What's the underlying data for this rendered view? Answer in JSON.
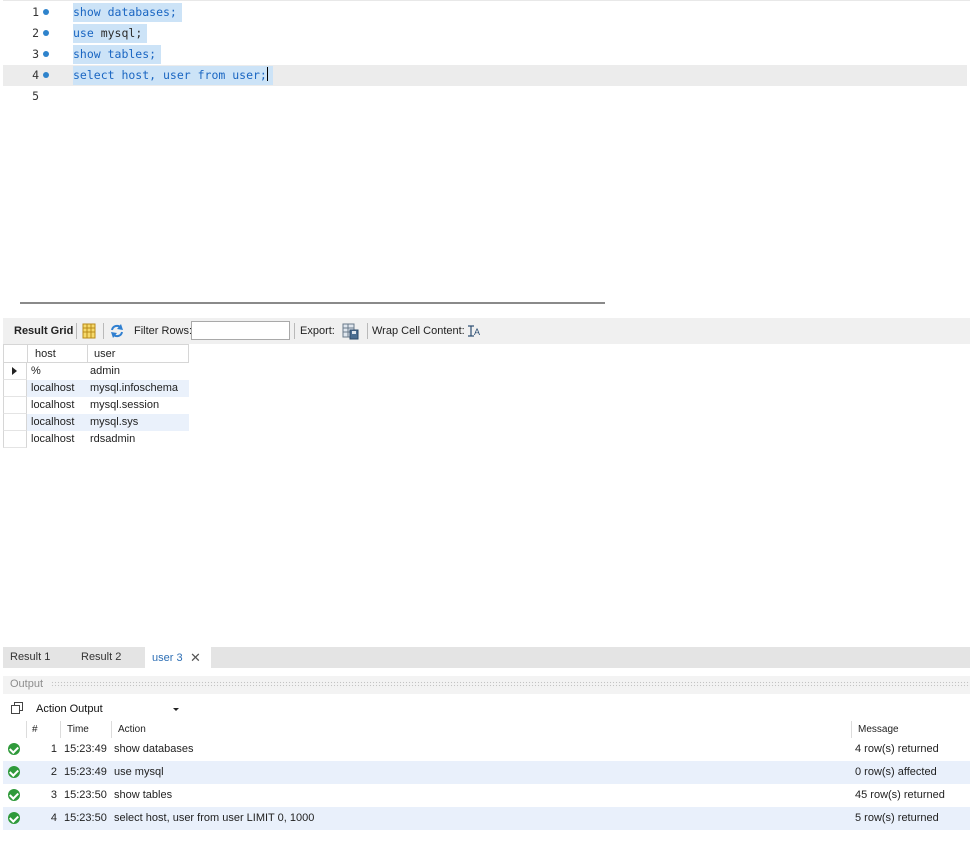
{
  "editor": {
    "lines": [
      {
        "number": "1",
        "tokens": [
          {
            "text": "show databases;",
            "type": "kw"
          }
        ]
      },
      {
        "number": "2",
        "tokens": [
          {
            "text": "use ",
            "type": "kw"
          },
          {
            "text": "mysql;",
            "type": "id"
          }
        ]
      },
      {
        "number": "3",
        "tokens": [
          {
            "text": "show tables;",
            "type": "kw"
          }
        ]
      },
      {
        "number": "4",
        "tokens": [
          {
            "text": "select host, user from user;",
            "type": "kw"
          }
        ]
      },
      {
        "number": "5",
        "tokens": []
      }
    ]
  },
  "result_toolbar": {
    "result_grid_label": "Result Grid",
    "filter_rows_label": "Filter Rows:",
    "filter_value": "",
    "export_label": "Export:",
    "wrap_label": "Wrap Cell Content:"
  },
  "grid": {
    "columns": [
      "host",
      "user"
    ],
    "rows": [
      {
        "host": "%",
        "user": "admin"
      },
      {
        "host": "localhost",
        "user": "mysql.infoschema"
      },
      {
        "host": "localhost",
        "user": "mysql.session"
      },
      {
        "host": "localhost",
        "user": "mysql.sys"
      },
      {
        "host": "localhost",
        "user": "rdsadmin"
      }
    ]
  },
  "result_tabs": [
    {
      "label": "Result 1",
      "active": false
    },
    {
      "label": "Result 2",
      "active": false
    },
    {
      "label": "user 3",
      "active": true
    }
  ],
  "output": {
    "title": "Output",
    "mode": "Action Output",
    "columns": [
      "#",
      "Time",
      "Action",
      "Message"
    ],
    "rows": [
      {
        "num": "1",
        "time": "15:23:49",
        "action": "show databases",
        "message": "4 row(s) returned"
      },
      {
        "num": "2",
        "time": "15:23:49",
        "action": "use mysql",
        "message": "0 row(s) affected"
      },
      {
        "num": "3",
        "time": "15:23:50",
        "action": "show tables",
        "message": "45 row(s) returned"
      },
      {
        "num": "4",
        "time": "15:23:50",
        "action": "select host, user from user LIMIT 0, 1000",
        "message": "5 row(s) returned"
      }
    ]
  },
  "colors": {
    "keyword": "#1a66c2",
    "selection": "#cce3f7",
    "active_tab": "#2e6fb5",
    "success": "#2f9a3b"
  }
}
